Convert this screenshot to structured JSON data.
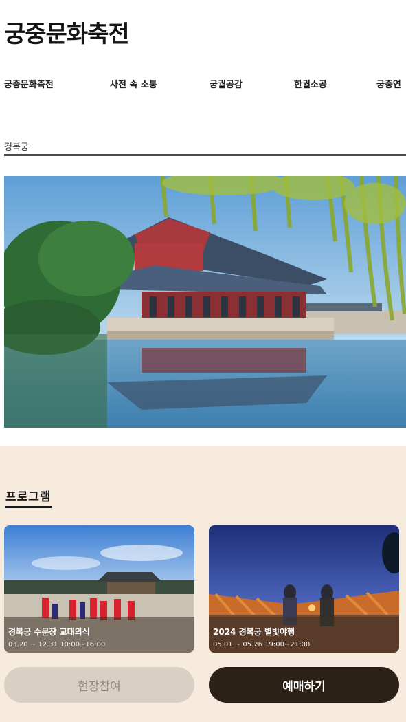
{
  "header": {
    "logo_text": "궁중문화축전"
  },
  "nav": {
    "items": [
      {
        "label": "궁중문화축전"
      },
      {
        "label": "사전 속 소통"
      },
      {
        "label": "궁궐공감"
      },
      {
        "label": "한궐소공"
      },
      {
        "label": "궁중연"
      }
    ]
  },
  "section": {
    "label": "경복궁"
  },
  "programs": {
    "title": "프로그램",
    "cards": [
      {
        "title": "경복궁 수문장 교대의식",
        "meta": "03.20 ~ 12.31 10:00~16:00"
      },
      {
        "title": "2024 경복궁 별빛야행",
        "meta": "05.01 ~ 05.26 19:00~21:00"
      }
    ],
    "buttons": {
      "onsite_label": "현장참여",
      "reserve_label": "예매하기"
    }
  },
  "colors": {
    "program_background": "#f6ebdd",
    "reserve_button": "#2c2116",
    "onsite_button": "#d8d1c3",
    "rule": "#4b4b4b"
  }
}
